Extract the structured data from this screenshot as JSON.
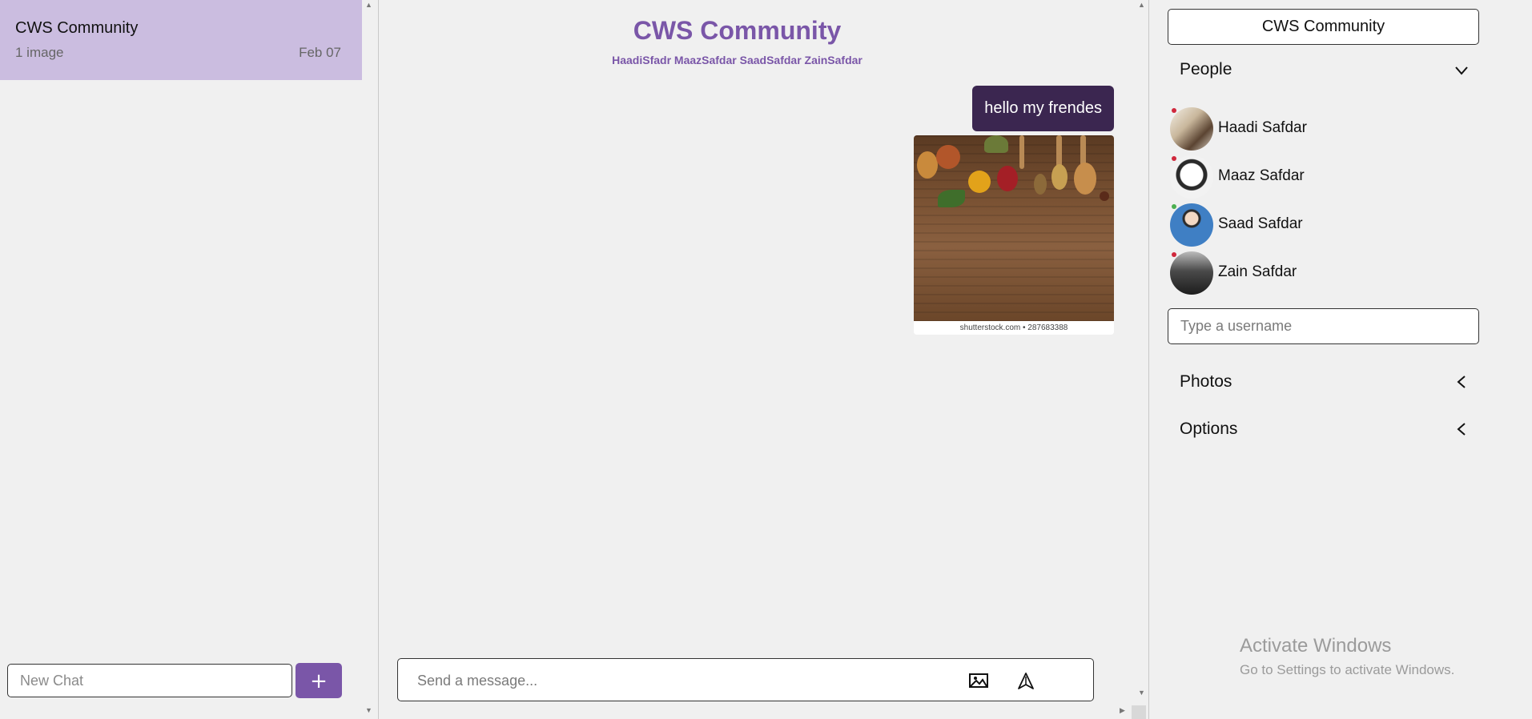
{
  "sidebar": {
    "chat": {
      "title": "CWS Community",
      "preview": "1 image",
      "date": "Feb 07"
    },
    "new_chat_placeholder": "New Chat",
    "add_button_label": "+"
  },
  "chat": {
    "title": "CWS Community",
    "members": "HaadiSfadr MaazSafdar SaadSafdar ZainSafdar",
    "messages": [
      {
        "type": "text",
        "text": "hello my frendes"
      },
      {
        "type": "image",
        "caption": "shutterstock.com • 287683388"
      }
    ],
    "composer_placeholder": "Send a message..."
  },
  "settings": {
    "chat_name": "CWS Community",
    "people_heading": "People",
    "people": [
      {
        "name": "Haadi Safdar",
        "status": "offline",
        "status_color": "#d0283c"
      },
      {
        "name": "Maaz Safdar",
        "status": "offline",
        "status_color": "#d0283c"
      },
      {
        "name": "Saad Safdar",
        "status": "online",
        "status_color": "#4caf50"
      },
      {
        "name": "Zain Safdar",
        "status": "offline",
        "status_color": "#d0283c"
      }
    ],
    "username_placeholder": "Type a username",
    "photos_heading": "Photos",
    "options_heading": "Options"
  },
  "os_watermark": {
    "title": "Activate Windows",
    "subtitle": "Go to Settings to activate Windows."
  },
  "colors": {
    "accent": "#7a56a8",
    "selected_chat": "#cbbde0",
    "own_message": "#3b2650",
    "background": "#f0f0f0"
  }
}
